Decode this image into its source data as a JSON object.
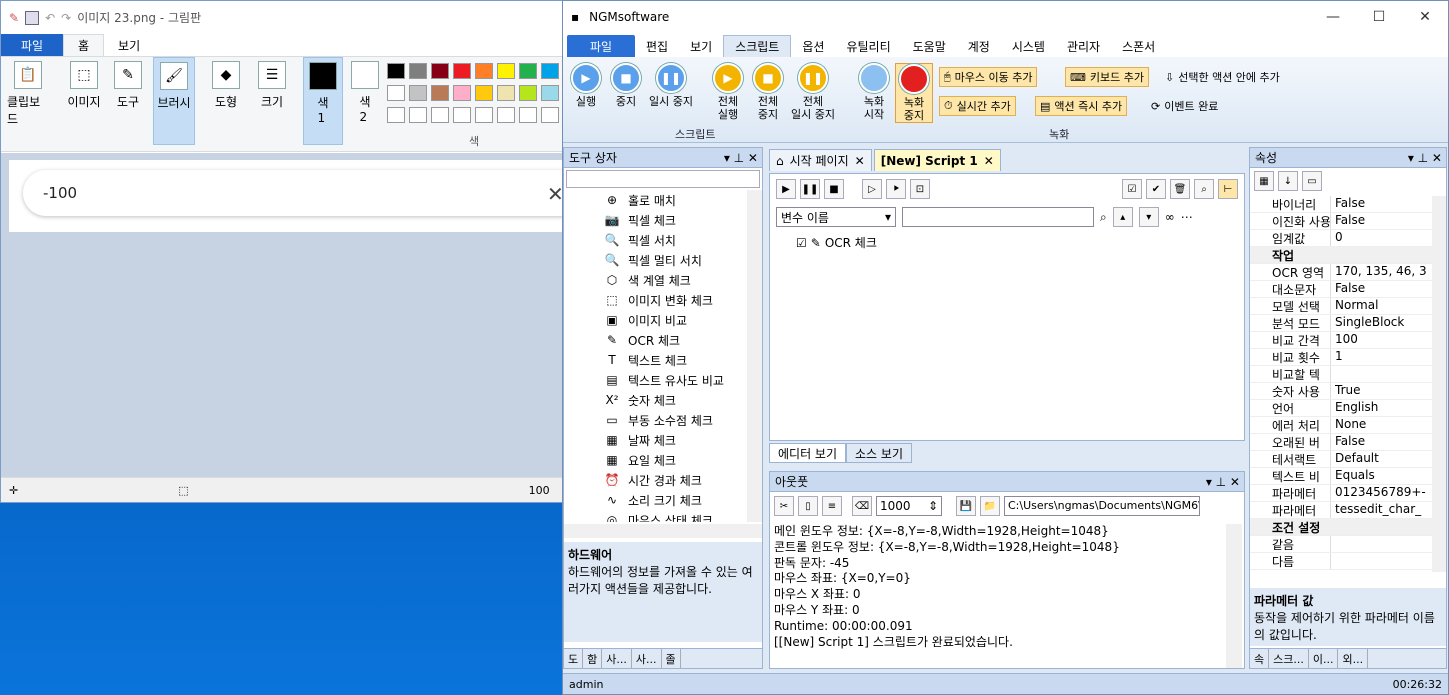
{
  "paint": {
    "title": "이미지 23.png - 그림판",
    "menu": {
      "file": "파일",
      "home": "홈",
      "view": "보기"
    },
    "ribbon": {
      "clipboard": "클립보드",
      "image": "이미지",
      "tools": "도구",
      "brush": "브러시",
      "shapes": "도형",
      "size": "크기",
      "color1": "색\n1",
      "color2": "색\n2",
      "colors": "색"
    },
    "palette": [
      "#000000",
      "#7f7f7f",
      "#880015",
      "#ed1c24",
      "#ff7f27",
      "#fff200",
      "#22b14c",
      "#00a2e8",
      "#ffffff",
      "#c3c3c3",
      "#b97a57",
      "#ffaec9",
      "#ffc90e",
      "#efe4b0",
      "#b5e61d",
      "#99d9ea"
    ],
    "search_text": "-100",
    "status_zoom": "100"
  },
  "ngm": {
    "title": "NGMsoftware",
    "tabs": [
      "파일",
      "편집",
      "보기",
      "스크립트",
      "옵션",
      "유틸리티",
      "도움말",
      "계정",
      "시스템",
      "관리자",
      "스폰서"
    ],
    "script_group": {
      "run": "실행",
      "stop": "중지",
      "pause": "일시 중지",
      "all_run": "전체\n실행",
      "all_stop": "전체\n중지",
      "all_pause": "전체\n일시 중지",
      "label": "스크립트"
    },
    "record_group": {
      "start": "녹화\n시작",
      "stop": "녹화\n중지",
      "mouse_move": "마우스 이동 추가",
      "keyboard": "키보드 추가",
      "selected": "선택한 액션 안에 추가",
      "realtime": "실시간 추가",
      "instant": "액션 즉시 추가",
      "event_done": "이벤트 완료",
      "label": "녹화"
    },
    "toolbox": {
      "title": "도구 상자",
      "items": [
        "홀로 매치",
        "픽셀 체크",
        "픽셀 서치",
        "픽셀 멀티 서치",
        "색 계열 체크",
        "이미지 변화 체크",
        "이미지 비교",
        "OCR 체크",
        "텍스트 체크",
        "텍스트 유사도 비교",
        "숫자 체크",
        "부동 소수점 체크",
        "날짜 체크",
        "요일 체크",
        "시간 경과 체크",
        "소리 크기 체크",
        "마우스 상태 체크"
      ],
      "desc_title": "하드웨어",
      "desc": "하드웨어의 정보를 가져올 수 있는 여러가지 액션들을 제공합니다.",
      "footer": [
        "도",
        "함",
        "사...",
        "사...",
        "졸"
      ]
    },
    "editor": {
      "tabs": [
        "시작 페이지",
        "[New] Script 1"
      ],
      "var_dropdown": "변수 이름",
      "node": "OCR 체크",
      "bottom_tabs": [
        "에디터 보기",
        "소스 보기"
      ]
    },
    "output": {
      "title": "아웃풋",
      "count": "1000",
      "path": "C:\\Users\\ngmas\\Documents\\NGM6\\",
      "lines": [
        "메인 윈도우 정보: {X=-8,Y=-8,Width=1928,Height=1048}",
        "콘트롤 윈도우 정보: {X=-8,Y=-8,Width=1928,Height=1048}",
        "판독 문자: -45",
        "마우스 좌표: {X=0,Y=0}",
        "마우스 X 좌표: 0",
        "마우스 Y 좌표: 0",
        "Runtime: 00:00:00.091",
        "[[New] Script 1] 스크립트가 완료되었습니다."
      ]
    },
    "properties": {
      "title": "속성",
      "rows": [
        {
          "k": "바이너리",
          "v": "False",
          "cat": false
        },
        {
          "k": "이진화 사용",
          "v": "False",
          "cat": false
        },
        {
          "k": "임계값",
          "v": "0",
          "cat": false
        },
        {
          "k": "작업",
          "v": "",
          "cat": true
        },
        {
          "k": "OCR 영역",
          "v": "170, 135, 46, 3",
          "cat": false
        },
        {
          "k": "대소문자",
          "v": "False",
          "cat": false
        },
        {
          "k": "모델 선택",
          "v": "Normal",
          "cat": false
        },
        {
          "k": "분석 모드",
          "v": "SingleBlock",
          "cat": false
        },
        {
          "k": "비교 간격",
          "v": "100",
          "cat": false
        },
        {
          "k": "비교 횟수",
          "v": "1",
          "cat": false
        },
        {
          "k": "비교할 텍",
          "v": "",
          "cat": false
        },
        {
          "k": "숫자 사용",
          "v": "True",
          "cat": false
        },
        {
          "k": "언어",
          "v": "English",
          "cat": false
        },
        {
          "k": "에러 처리",
          "v": "None",
          "cat": false
        },
        {
          "k": "오래된 버",
          "v": "False",
          "cat": false
        },
        {
          "k": "테서랙트",
          "v": "Default",
          "cat": false
        },
        {
          "k": "텍스트 비",
          "v": "Equals",
          "cat": false
        },
        {
          "k": "파라메터",
          "v": "0123456789+-",
          "cat": false
        },
        {
          "k": "파라메터",
          "v": "tessedit_char_",
          "cat": false
        },
        {
          "k": "조건 설정",
          "v": "",
          "cat": true
        },
        {
          "k": "같음",
          "v": "",
          "cat": false
        },
        {
          "k": "다름",
          "v": "",
          "cat": false
        }
      ],
      "desc_title": "파라메터 값",
      "desc": "동작을 제어하기 위한 파라메터 이름의 값입니다.",
      "footer": [
        "속",
        "스크...",
        "이...",
        "외..."
      ]
    },
    "status": {
      "user": "admin",
      "time": "00:26:32"
    }
  }
}
